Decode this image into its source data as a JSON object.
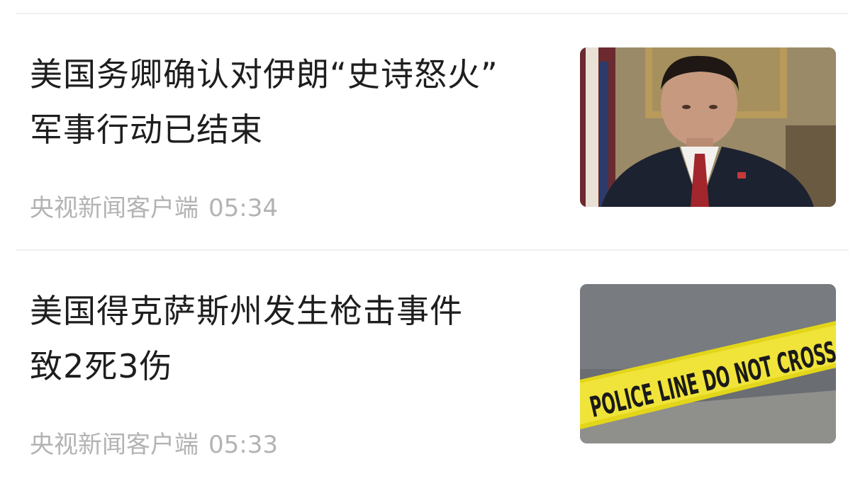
{
  "feed": {
    "items": [
      {
        "title_line1": "美国务卿确认对伊朗“史诗怒火”",
        "title_line2": "军事行动已结束",
        "source": "央视新闻客户端",
        "time": "05:34",
        "thumbnail": "man-in-suit-photo"
      },
      {
        "title_line1": "美国得克萨斯州发生枪击事件",
        "title_line2": "致2死3伤",
        "source": "央视新闻客户端",
        "time": "05:33",
        "thumbnail": "police-tape-photo",
        "thumbnail_text": "POLICE LINE DO NOT CROSS"
      }
    ]
  }
}
